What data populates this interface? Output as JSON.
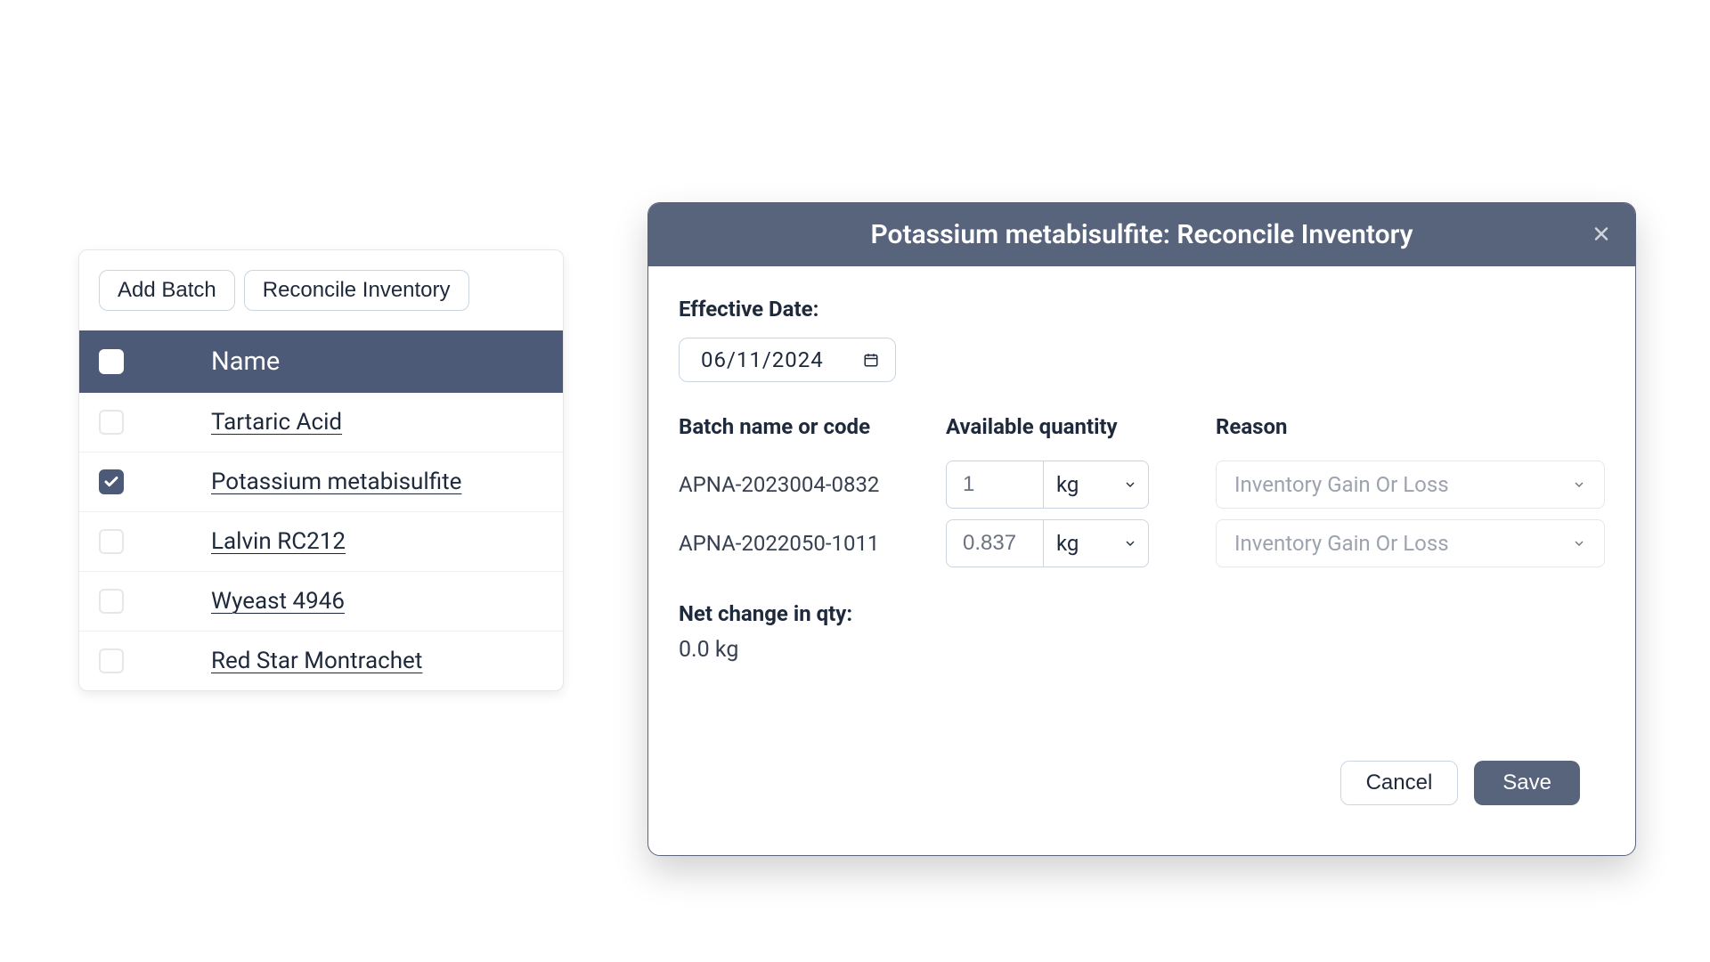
{
  "toolbar": {
    "add_batch": "Add Batch",
    "reconcile": "Reconcile Inventory"
  },
  "table": {
    "header": "Name",
    "rows": [
      {
        "name": "Tartaric Acid",
        "checked": false
      },
      {
        "name": "Potassium metabisulfite",
        "checked": true
      },
      {
        "name": "Lalvin RC212",
        "checked": false
      },
      {
        "name": "Wyeast 4946",
        "checked": false
      },
      {
        "name": "Red Star Montrachet",
        "checked": false
      }
    ]
  },
  "dialog": {
    "title": "Potassium metabisulfite: Reconcile Inventory",
    "effective_date_label": "Effective Date:",
    "effective_date_value": "06/11/2024",
    "col_batch": "Batch name or code",
    "col_qty": "Available quantity",
    "col_reason": "Reason",
    "batches": [
      {
        "code": "APNA-2023004-0832",
        "qty": "1",
        "unit": "kg",
        "reason": "Inventory Gain Or Loss"
      },
      {
        "code": "APNA-2022050-1011",
        "qty": "0.837",
        "unit": "kg",
        "reason": "Inventory Gain Or Loss"
      }
    ],
    "net_label": "Net change in qty:",
    "net_value": "0.0 kg",
    "cancel": "Cancel",
    "save": "Save"
  }
}
